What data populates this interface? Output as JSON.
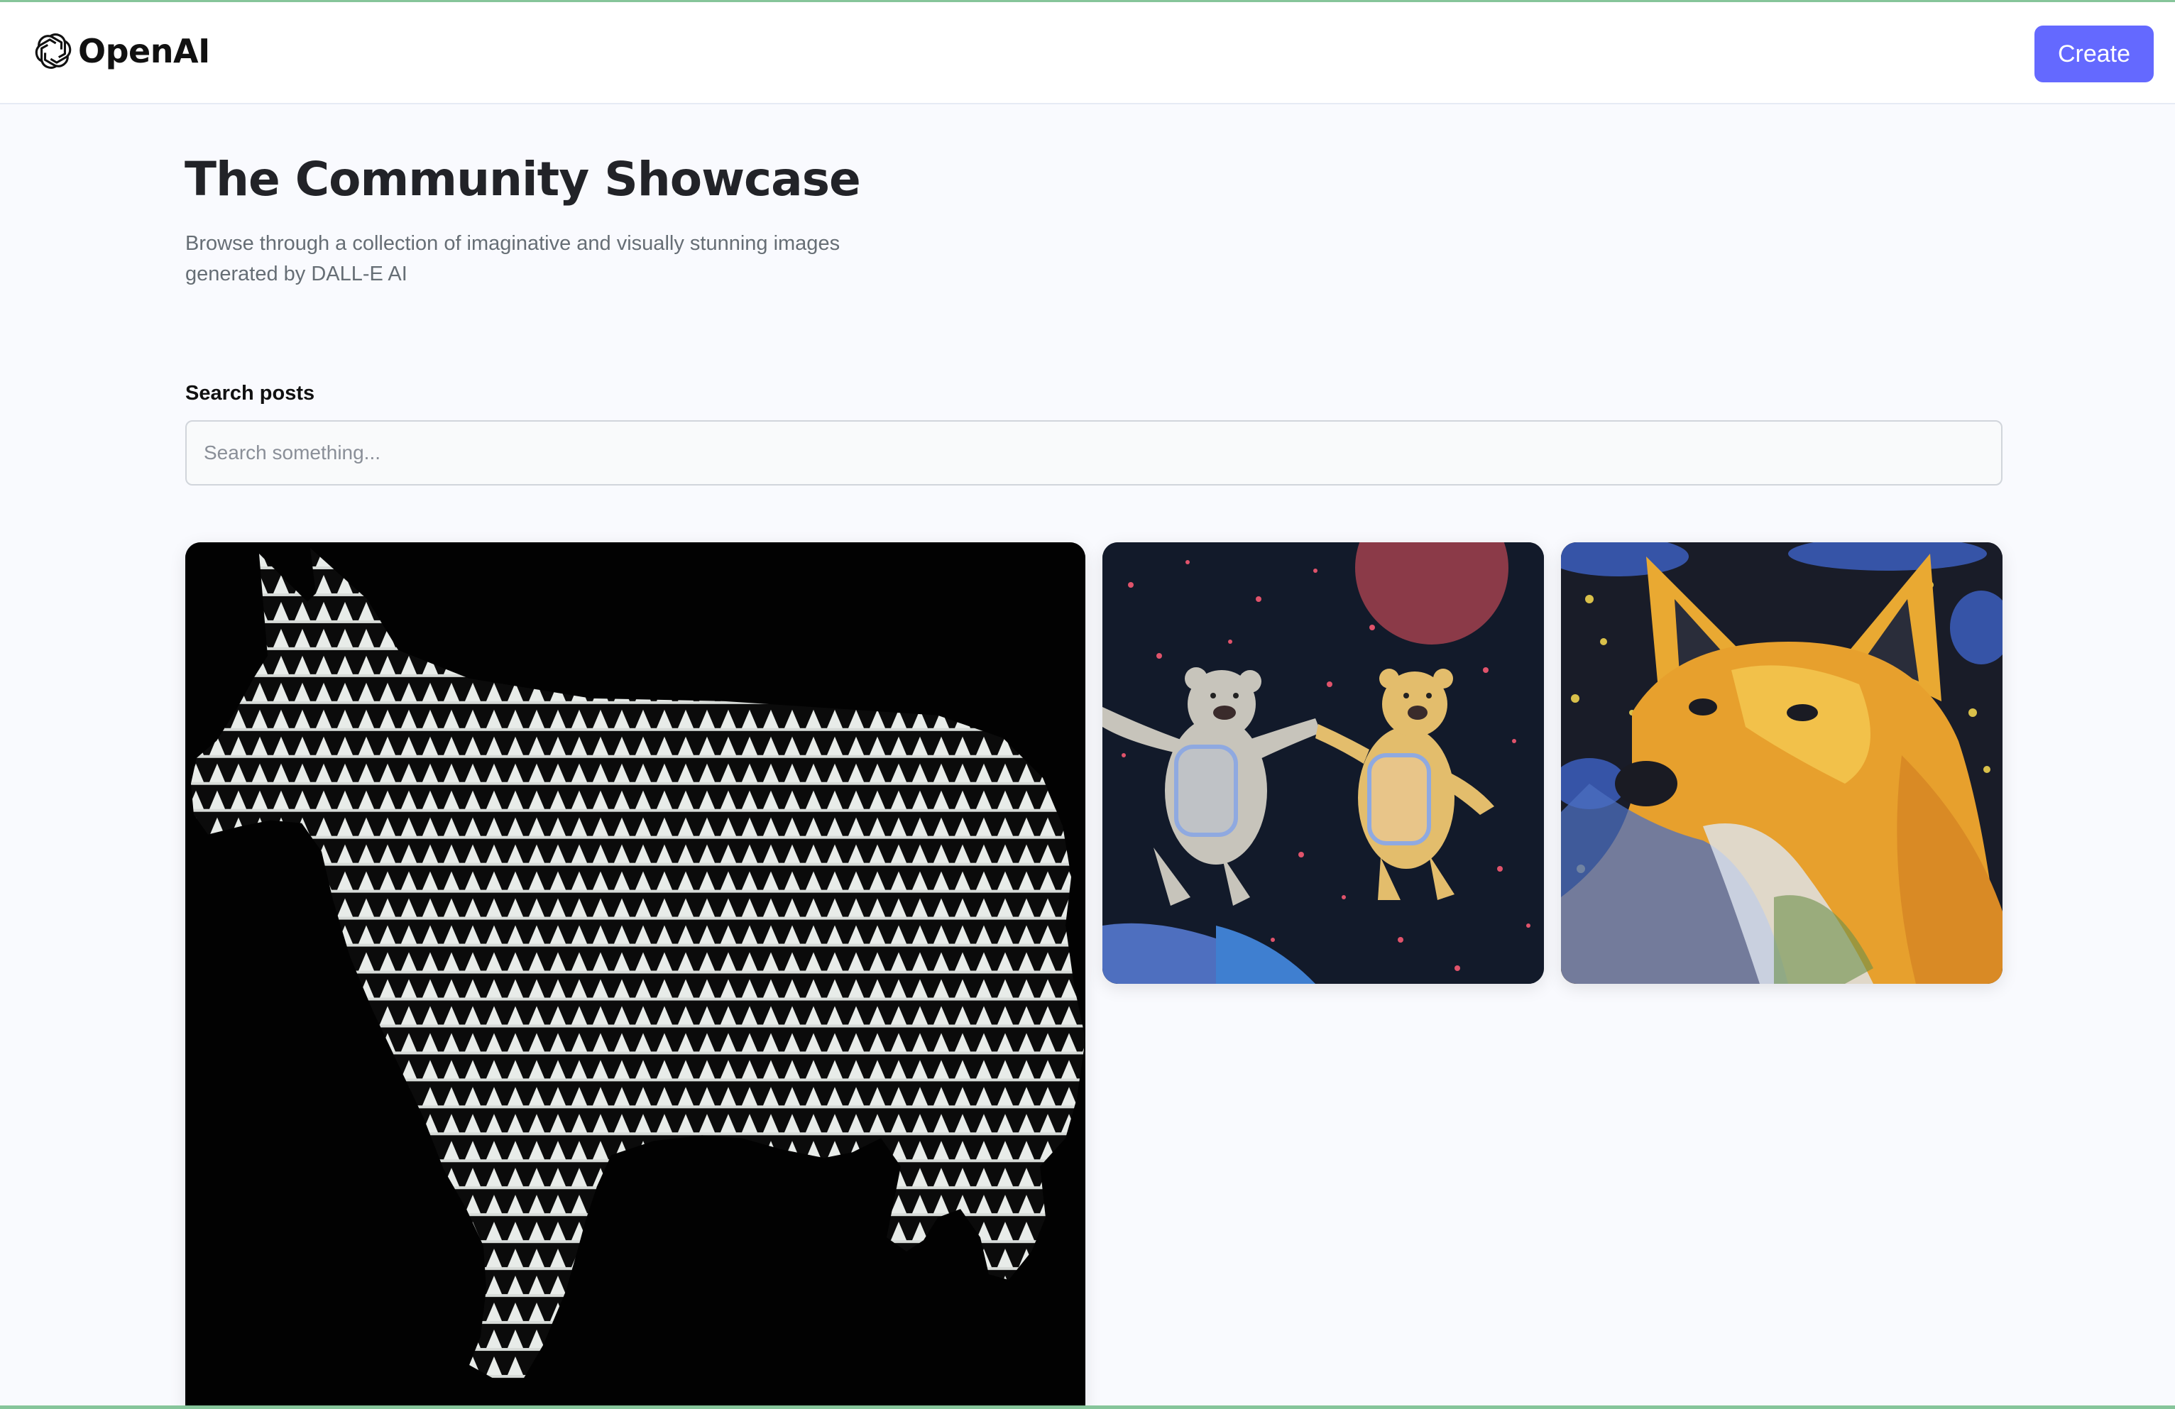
{
  "header": {
    "logo_text": "OpenAI",
    "logo_icon": "openai-logo-icon",
    "create_label": "Create"
  },
  "showcase": {
    "title": "The Community Showcase",
    "subtitle": "Browse through a collection of imaginative and visually stunning images generated by DALL-E AI"
  },
  "search": {
    "label": "Search posts",
    "placeholder": "Search something...",
    "value": ""
  },
  "posts": [
    {
      "image": "wolf-pattern-image"
    },
    {
      "image": "space-bears-image"
    },
    {
      "image": "fox-painting-image"
    }
  ],
  "colors": {
    "accent": "#6469ff",
    "background": "#f9fafe",
    "title": "#222328",
    "muted_text": "#666e75",
    "frame_line": "#86c59a"
  }
}
